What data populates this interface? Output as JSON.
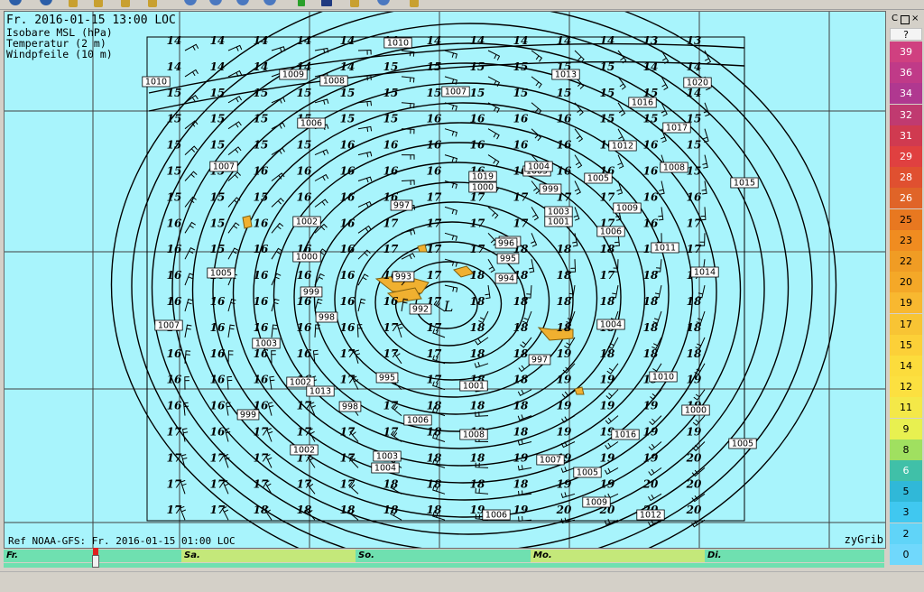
{
  "info": {
    "date_line": "Fr. 2016-01-15 13:00 LOC",
    "layers": [
      "Isobare MSL (hPa)",
      "Temperatur (2 m)",
      "Windpfeile (10 m)"
    ]
  },
  "ref_line": "Ref NOAA-GFS: Fr. 2016-01-15 01:00 LOC",
  "app_name": "zyGrib",
  "low_label": "L",
  "toolbar": {
    "icons": [
      "arrow-left-icon",
      "arrow-right-icon",
      "tool-1-icon",
      "tool-2-icon",
      "tool-3-icon",
      "tool-4-icon",
      "info-1-icon",
      "info-2-icon",
      "info-3-icon",
      "info-4-icon",
      "check-icon",
      "chart-icon",
      "palette-icon",
      "settings-icon",
      "measure-icon"
    ]
  },
  "timeline": {
    "days": [
      {
        "label": "Fr.",
        "color": "#6fe0b0"
      },
      {
        "label": "Sa.",
        "color": "#c4e87a"
      },
      {
        "label": "So.",
        "color": "#6fe0b0"
      },
      {
        "label": "Mo.",
        "color": "#c4e87a"
      },
      {
        "label": "Di.",
        "color": "#6fe0b0"
      }
    ]
  },
  "colorscale": {
    "header_icons": [
      "C",
      "restore-icon"
    ],
    "unknown_label": "?",
    "entries": [
      {
        "value": "39",
        "color": "#d04080",
        "text_color": "#fff"
      },
      {
        "value": "36",
        "color": "#c03a88",
        "text_color": "#fff"
      },
      {
        "value": "34",
        "color": "#b03890",
        "text_color": "#fff"
      },
      {
        "value": "32",
        "color": "#c03a70",
        "text_color": "#fff"
      },
      {
        "value": "31",
        "color": "#d03a50",
        "text_color": "#fff"
      },
      {
        "value": "29",
        "color": "#e04040",
        "text_color": "#fff"
      },
      {
        "value": "28",
        "color": "#e05030",
        "text_color": "#fff"
      },
      {
        "value": "26",
        "color": "#e06428",
        "text_color": "#fff"
      },
      {
        "value": "25",
        "color": "#e87820",
        "text_color": "#000"
      },
      {
        "value": "23",
        "color": "#f08c20",
        "text_color": "#000"
      },
      {
        "value": "22",
        "color": "#f09c24",
        "text_color": "#000"
      },
      {
        "value": "20",
        "color": "#f4a828",
        "text_color": "#000"
      },
      {
        "value": "19",
        "color": "#f8b830",
        "text_color": "#000"
      },
      {
        "value": "17",
        "color": "#f8c434",
        "text_color": "#000"
      },
      {
        "value": "15",
        "color": "#fcd038",
        "text_color": "#000"
      },
      {
        "value": "14",
        "color": "#fcdc3c",
        "text_color": "#000"
      },
      {
        "value": "12",
        "color": "#fce040",
        "text_color": "#000"
      },
      {
        "value": "11",
        "color": "#f4e848",
        "text_color": "#000"
      },
      {
        "value": "9",
        "color": "#e8f050",
        "text_color": "#000"
      },
      {
        "value": "8",
        "color": "#a0e060",
        "text_color": "#000"
      },
      {
        "value": "6",
        "color": "#40c0a8",
        "text_color": "#fff"
      },
      {
        "value": "5",
        "color": "#30b8d8",
        "text_color": "#000"
      },
      {
        "value": "3",
        "color": "#40c8f0",
        "text_color": "#000"
      },
      {
        "value": "2",
        "color": "#60d4f8",
        "text_color": "#000"
      },
      {
        "value": "0",
        "color": "#70d8fc",
        "text_color": "#000"
      }
    ]
  },
  "map": {
    "colors": {
      "sea": "#a8f4fc",
      "land": "#f0b030",
      "grid": "#404040",
      "isobar": "#000000",
      "label_bg": "#ffffff"
    },
    "temperature_grid": [
      [
        "14",
        "14",
        "14",
        "14",
        "14",
        "14",
        "14",
        "14",
        "14",
        "14",
        "14",
        "13",
        "13"
      ],
      [
        "14",
        "14",
        "14",
        "14",
        "14",
        "15",
        "15",
        "15",
        "15",
        "15",
        "15",
        "14",
        "14"
      ],
      [
        "15",
        "15",
        "15",
        "15",
        "15",
        "15",
        "15",
        "15",
        "15",
        "15",
        "15",
        "15",
        "14"
      ],
      [
        "15",
        "15",
        "15",
        "15",
        "15",
        "15",
        "16",
        "16",
        "16",
        "16",
        "15",
        "15",
        "15"
      ],
      [
        "15",
        "15",
        "15",
        "15",
        "16",
        "16",
        "16",
        "16",
        "16",
        "16",
        "16",
        "16",
        "15"
      ],
      [
        "15",
        "15",
        "16",
        "16",
        "16",
        "16",
        "16",
        "16",
        "16",
        "16",
        "16",
        "16",
        "15"
      ],
      [
        "15",
        "15",
        "15",
        "16",
        "16",
        "16",
        "17",
        "17",
        "17",
        "17",
        "17",
        "16",
        "16"
      ],
      [
        "16",
        "15",
        "16",
        "16",
        "16",
        "17",
        "17",
        "17",
        "17",
        "17",
        "17",
        "16",
        "17"
      ],
      [
        "16",
        "15",
        "16",
        "16",
        "16",
        "17",
        "17",
        "17",
        "18",
        "18",
        "18",
        "17",
        "17"
      ],
      [
        "16",
        "16",
        "16",
        "16",
        "16",
        "16",
        "17",
        "18",
        "18",
        "18",
        "17",
        "18",
        "17"
      ],
      [
        "16",
        "16",
        "16",
        "16",
        "16",
        "16",
        "17",
        "18",
        "18",
        "18",
        "18",
        "18",
        "18"
      ],
      [
        "16",
        "16",
        "16",
        "16",
        "16",
        "17",
        "17",
        "18",
        "18",
        "18",
        "18",
        "18",
        "18"
      ],
      [
        "16",
        "16",
        "16",
        "16",
        "17",
        "17",
        "17",
        "18",
        "18",
        "19",
        "18",
        "18",
        "18"
      ],
      [
        "16",
        "16",
        "16",
        "16",
        "17",
        "17",
        "17",
        "18",
        "18",
        "19",
        "19",
        "19",
        "19"
      ],
      [
        "16",
        "16",
        "16",
        "17",
        "17",
        "17",
        "18",
        "18",
        "18",
        "19",
        "19",
        "19",
        "19"
      ],
      [
        "17",
        "16",
        "17",
        "17",
        "17",
        "17",
        "18",
        "18",
        "18",
        "19",
        "19",
        "19",
        "19"
      ],
      [
        "17",
        "17",
        "17",
        "17",
        "17",
        "18",
        "18",
        "18",
        "19",
        "19",
        "19",
        "19",
        "20"
      ],
      [
        "17",
        "17",
        "17",
        "17",
        "17",
        "18",
        "18",
        "18",
        "18",
        "19",
        "19",
        "20",
        "20"
      ],
      [
        "17",
        "17",
        "18",
        "18",
        "18",
        "18",
        "18",
        "19",
        "19",
        "20",
        "20",
        "20",
        "20"
      ]
    ],
    "pressure_labels": [
      "1010",
      "1010",
      "1009",
      "1008",
      "1007",
      "1013",
      "1020",
      "1016",
      "1006",
      "1005",
      "1017",
      "1012",
      "1007",
      "1004",
      "1005",
      "1008",
      "1015",
      "1019",
      "1000",
      "999",
      "1003",
      "996",
      "997",
      "1009",
      "1002",
      "1001",
      "1006",
      "1011",
      "996",
      "1000",
      "995",
      "1005",
      "1014",
      "993",
      "994",
      "999",
      "998",
      "992",
      "1004",
      "1007",
      "1003",
      "997",
      "1010",
      "1002",
      "995",
      "1001",
      "1013",
      "1000",
      "998",
      "1006",
      "999",
      "1008",
      "1016",
      "1005",
      "1002",
      "1003",
      "1004",
      "1007",
      "1005",
      "1009",
      "1006",
      "1012"
    ]
  }
}
